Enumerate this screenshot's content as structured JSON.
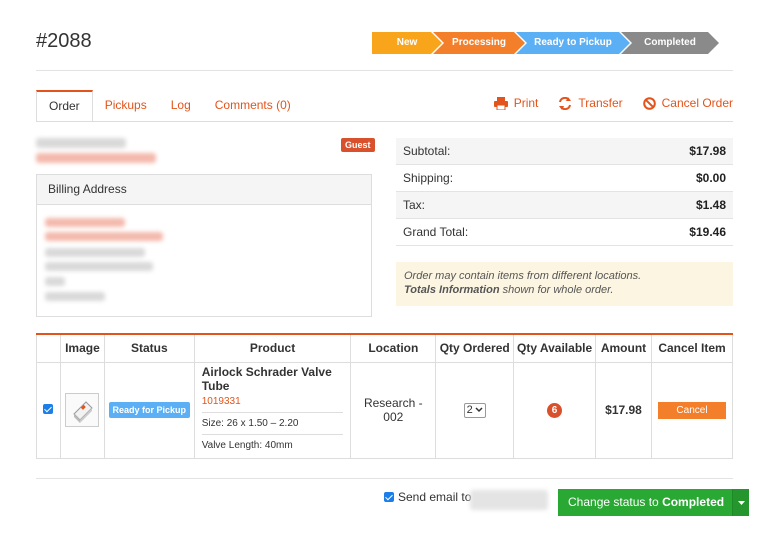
{
  "order": {
    "title": "#2088"
  },
  "steps": [
    {
      "label": "New",
      "color": "#f9a51c"
    },
    {
      "label": "Processing",
      "color": "#f47f2a"
    },
    {
      "label": "Ready to Pickup",
      "color": "#5bb0f5"
    },
    {
      "label": "Completed",
      "color": "#8a8a8a"
    }
  ],
  "tabs": [
    "Order",
    "Pickups",
    "Log",
    "Comments (0)"
  ],
  "actions": {
    "print": {
      "label": "Print",
      "icon": "printer-icon"
    },
    "transfer": {
      "label": "Transfer",
      "icon": "transfer-icon"
    },
    "cancel": {
      "label": "Cancel Order",
      "icon": "cancel-icon"
    }
  },
  "customer": {
    "badge": "Guest"
  },
  "billing": {
    "title": "Billing Address"
  },
  "totals": [
    {
      "label": "Subtotal:",
      "value": "$17.98"
    },
    {
      "label": "Shipping:",
      "value": "$0.00"
    },
    {
      "label": "Tax:",
      "value": "$1.48"
    },
    {
      "label": "Grand Total:",
      "value": "$19.46"
    }
  ],
  "notice": {
    "line1": "Order may contain items from different locations.",
    "bold": "Totals Information",
    "line2_rest": " shown for whole order."
  },
  "table": {
    "headers": [
      "",
      "Image",
      "Status",
      "Product",
      "Location",
      "Qty Ordered",
      "Qty Available",
      "Amount",
      "Cancel Item"
    ],
    "row": {
      "checked": true,
      "status": "Ready for Pickup",
      "product_name": "Airlock Schrader Valve Tube",
      "sku": "1019331",
      "size": "Size: 26 x 1.50 – 2.20",
      "valve": "Valve Length: 40mm",
      "location": "Research - 002",
      "qty_ordered": "2",
      "qty_available": "6",
      "amount": "$17.98",
      "cancel_label": "Cancel"
    }
  },
  "footer": {
    "send_email_label": "Send email to",
    "change_status_prefix": "Change status to ",
    "change_status_target": "Completed"
  },
  "colors": {
    "accent": "#e2541b",
    "primary_action": "#29a833"
  }
}
